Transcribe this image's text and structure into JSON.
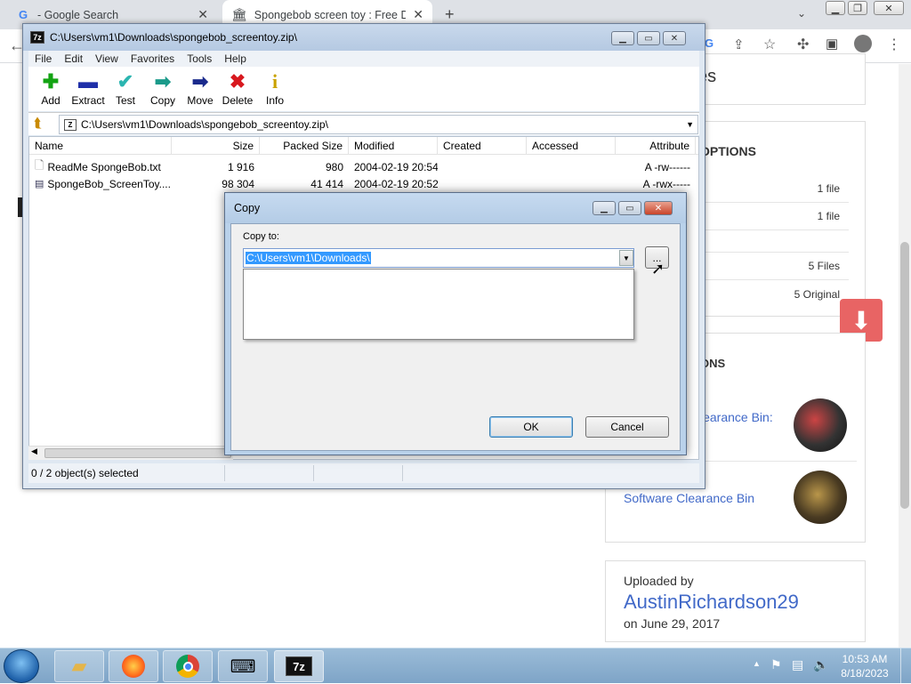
{
  "browser": {
    "tabs": [
      {
        "label": "- Google Search",
        "favicon": "google-icon"
      },
      {
        "label": "Spongebob screen toy : Free Do",
        "favicon": "archive-icon"
      }
    ],
    "new_tab": "+",
    "page_partial_title": "es",
    "sidebar": {
      "options_heading": "OPTIONS",
      "rows": [
        "1 file",
        "1 file",
        "",
        "5 Files",
        "5 Original"
      ],
      "collections_heading": "ONS",
      "items": [
        {
          "label": "learance Bin:"
        },
        {
          "label": "Software Clearance Bin"
        }
      ],
      "uploaded_by_label": "Uploaded by",
      "uploader": "AustinRichardson29",
      "upload_date": "on June 29, 2017"
    }
  },
  "zip": {
    "title": "C:\\Users\\vm1\\Downloads\\spongebob_screentoy.zip\\",
    "app_icon": "7z",
    "menu": [
      "File",
      "Edit",
      "View",
      "Favorites",
      "Tools",
      "Help"
    ],
    "toolbar": [
      {
        "label": "Add",
        "icon": "plus-icon",
        "glyph": "✚",
        "color": "#13a313"
      },
      {
        "label": "Extract",
        "icon": "minus-icon",
        "glyph": "▬",
        "color": "#1f2fa8"
      },
      {
        "label": "Test",
        "icon": "check-icon",
        "glyph": "✔",
        "color": "#2bb5b0"
      },
      {
        "label": "Copy",
        "icon": "copy-arrow-icon",
        "glyph": "➡",
        "color": "#1a9a8a"
      },
      {
        "label": "Move",
        "icon": "move-arrow-icon",
        "glyph": "➡",
        "color": "#1a2a8c"
      },
      {
        "label": "Delete",
        "icon": "delete-x-icon",
        "glyph": "✖",
        "color": "#d8191f"
      },
      {
        "label": "Info",
        "icon": "info-icon",
        "glyph": "i",
        "color": "#c9a200"
      }
    ],
    "address": "C:\\Users\\vm1\\Downloads\\spongebob_screentoy.zip\\",
    "columns": [
      "Name",
      "Size",
      "Packed Size",
      "Modified",
      "Created",
      "Accessed",
      "Attribute"
    ],
    "rows": [
      {
        "name": "ReadMe SpongeBob.txt",
        "size": "1 916",
        "packed": "980",
        "modified": "2004-02-19 20:54",
        "created": "",
        "accessed": "",
        "attr": "A -rw------"
      },
      {
        "name": "SpongeBob_ScreenToy....",
        "size": "98 304",
        "packed": "41 414",
        "modified": "2004-02-19 20:52",
        "created": "",
        "accessed": "",
        "attr": "A -rwx-----"
      }
    ],
    "status": "0 / 2 object(s) selected"
  },
  "copy_dialog": {
    "title": "Copy",
    "copy_to_label": "Copy to:",
    "path_value": "C:\\Users\\vm1\\Downloads\\",
    "browse_label": "...",
    "ok_label": "OK",
    "cancel_label": "Cancel"
  },
  "taskbar": {
    "time": "10:53 AM",
    "date": "8/18/2023"
  }
}
